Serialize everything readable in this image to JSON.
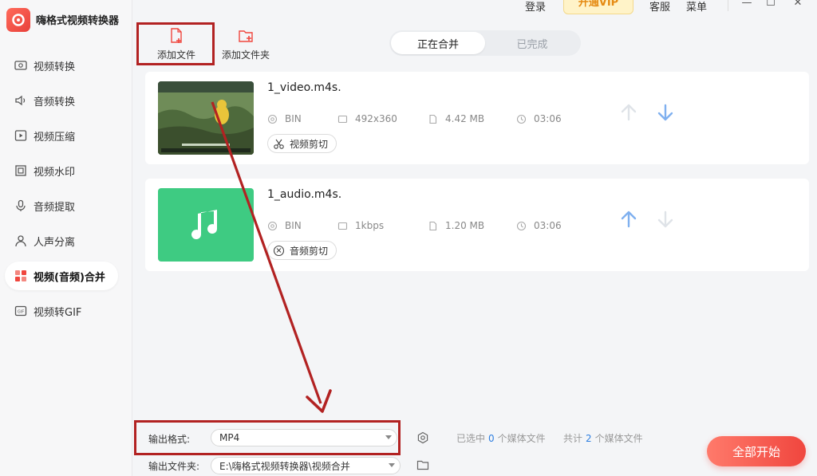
{
  "app": {
    "name": "嗨格式视频转换器"
  },
  "topbar": {
    "login": "登录",
    "vip": "开通VIP",
    "service": "客服",
    "menu": "菜单",
    "minimize": "—",
    "maximize": "☐",
    "close": "✕"
  },
  "sidebar": {
    "items": [
      {
        "label": "视频转换",
        "icon": "video-convert-icon"
      },
      {
        "label": "音频转换",
        "icon": "audio-convert-icon"
      },
      {
        "label": "视频压缩",
        "icon": "video-compress-icon"
      },
      {
        "label": "视频水印",
        "icon": "video-watermark-icon"
      },
      {
        "label": "音频提取",
        "icon": "audio-extract-icon"
      },
      {
        "label": "人声分离",
        "icon": "vocal-separation-icon"
      },
      {
        "label": "视频(音频)合并",
        "icon": "merge-icon",
        "active": true
      },
      {
        "label": "视频转GIF",
        "icon": "gif-icon"
      }
    ]
  },
  "toolbar": {
    "add_file": "添加文件",
    "add_folder": "添加文件夹"
  },
  "tabs": {
    "merging": "正在合并",
    "done": "已完成"
  },
  "files": [
    {
      "name": "1_video.m4s.",
      "format": "BIN",
      "resolution": "492x360",
      "size": "4.42 MB",
      "duration": "03:06",
      "action": "视频剪切",
      "thumb": "video-thumbnail"
    },
    {
      "name": "1_audio.m4s.",
      "format": "BIN",
      "resolution": "1kbps",
      "size": "1.20 MB",
      "duration": "03:06",
      "action": "音频剪切",
      "thumb": "music-icon"
    }
  ],
  "output": {
    "format_label": "输出格式:",
    "format_value": "MP4",
    "folder_label": "输出文件夹:",
    "folder_value": "E:\\嗨格式视频转换器\\视频合并"
  },
  "status": {
    "selected_prefix": "已选中",
    "selected_count": "0",
    "selected_suffix": "个媒体文件",
    "total_prefix": "共计",
    "total_count": "2",
    "total_suffix": "个媒体文件"
  },
  "start_button": "全部开始",
  "colors": {
    "accent": "#f0463e",
    "annotation": "#b22222",
    "link": "#2f7fe0",
    "arrow_active": "#7fb0ef",
    "arrow_disabled": "#dfe3e8"
  }
}
